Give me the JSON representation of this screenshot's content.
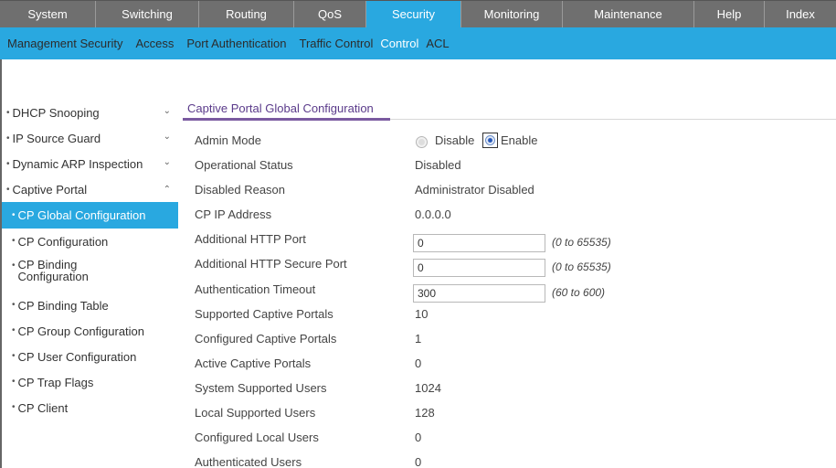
{
  "top_nav": {
    "tabs": [
      {
        "label": "System"
      },
      {
        "label": "Switching"
      },
      {
        "label": "Routing"
      },
      {
        "label": "QoS"
      },
      {
        "label": "Security",
        "active": true
      },
      {
        "label": "Monitoring"
      },
      {
        "label": "Maintenance"
      },
      {
        "label": "Help"
      },
      {
        "label": "Index"
      }
    ]
  },
  "sub_nav": {
    "items": [
      {
        "label": "Management Security"
      },
      {
        "label": "Access"
      },
      {
        "label": "Port Authentication"
      },
      {
        "label": "Traffic Control"
      },
      {
        "label": "Control",
        "active": true
      },
      {
        "label": "ACL"
      }
    ]
  },
  "sidebar": {
    "items": [
      {
        "label": "DHCP Snooping",
        "chevron": "chevron-down-icon"
      },
      {
        "label": "IP Source Guard",
        "chevron": "chevron-down-icon"
      },
      {
        "label": "Dynamic ARP Inspection",
        "chevron": "chevron-down-icon"
      },
      {
        "label": "Captive Portal",
        "chevron": "chevron-up-icon"
      }
    ],
    "sub_items": [
      {
        "label": "CP Global Configuration",
        "active": true
      },
      {
        "label": "CP Configuration"
      },
      {
        "label": "CP Binding Configuration"
      },
      {
        "label": "CP Binding Table"
      },
      {
        "label": "CP Group Configuration"
      },
      {
        "label": "CP User Configuration"
      },
      {
        "label": "CP Trap Flags"
      },
      {
        "label": "CP Client"
      }
    ]
  },
  "main": {
    "section_title": "Captive Portal Global Configuration",
    "admin_mode": {
      "label": "Admin Mode",
      "options": [
        "Disable",
        "Enable"
      ],
      "selected": "Enable"
    },
    "rows": {
      "operational_status": {
        "label": "Operational Status",
        "value": "Disabled"
      },
      "disabled_reason": {
        "label": "Disabled Reason",
        "value": "Administrator Disabled"
      },
      "cp_ip_address": {
        "label": "CP IP Address",
        "value": "0.0.0.0"
      },
      "additional_http_port": {
        "label": "Additional HTTP Port",
        "value": "0",
        "hint": "(0 to 65535)"
      },
      "additional_http_secure_port": {
        "label": "Additional HTTP Secure Port",
        "value": "0",
        "hint": "(0 to 65535)"
      },
      "authentication_timeout": {
        "label": "Authentication Timeout",
        "value": "300",
        "hint": "(60 to 600)"
      },
      "supported_captive_portals": {
        "label": "Supported Captive Portals",
        "value": "10"
      },
      "configured_captive_portals": {
        "label": "Configured Captive Portals",
        "value": "1"
      },
      "active_captive_portals": {
        "label": "Active Captive Portals",
        "value": "0"
      },
      "system_supported_users": {
        "label": "System Supported Users",
        "value": "1024"
      },
      "local_supported_users": {
        "label": "Local Supported Users",
        "value": "128"
      },
      "configured_local_users": {
        "label": "Configured Local Users",
        "value": "0"
      },
      "authenticated_users": {
        "label": "Authenticated Users",
        "value": "0"
      }
    }
  },
  "colors": {
    "nav_gray": "#6f6f6f",
    "accent_blue": "#29a8e0",
    "section_purple": "#5a3a8a"
  }
}
